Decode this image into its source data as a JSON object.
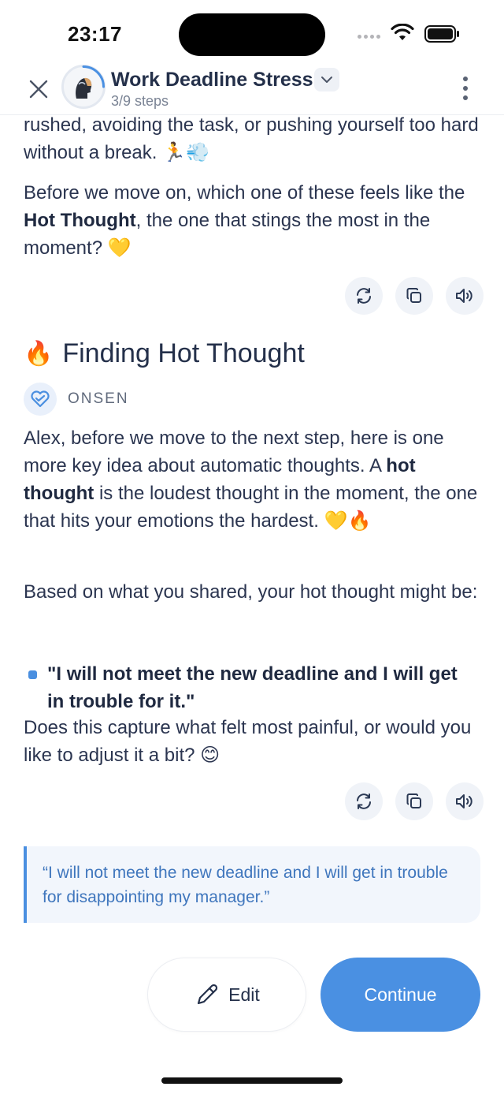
{
  "status_bar": {
    "time": "23:17"
  },
  "header": {
    "title": "Work Deadline Stress",
    "steps": "3/9 steps"
  },
  "message1": {
    "continued_text": "rushed, avoiding the task, or pushing yourself too hard without a break.",
    "question_before": "Before we move on, which one of these feels like the ",
    "question_bold": "Hot Thought",
    "question_after": ", the one that stings the most in the moment?"
  },
  "section": {
    "title": "Finding Hot Thought",
    "author": "ONSEN"
  },
  "message2": {
    "intro_before": "Alex, before we move to the next step, here is one more key idea about automatic thoughts. A ",
    "intro_bold": "hot thought",
    "intro_after": " is the loudest thought in the moment, the one that hits your emotions the hardest.",
    "lead": "Based on what you shared, your hot thought might be:",
    "bullet": "\"I will not meet the new deadline and I will get in trouble for it.\"",
    "question": "Does this capture what felt most painful, or would you like to adjust it a bit?"
  },
  "user_reply": {
    "quote": "“I will not meet the new deadline and I will get in trouble for disappointing my manager.”"
  },
  "buttons": {
    "edit": "Edit",
    "continue": "Continue"
  },
  "icons": {
    "close": "close-icon",
    "chevron": "chevron-down-icon",
    "more": "more-vertical-icon",
    "regenerate": "refresh-icon",
    "copy": "copy-icon",
    "speaker": "speaker-icon",
    "edit": "pencil-icon"
  },
  "colors": {
    "accent": "#4a90e2",
    "quote_text": "#3f76bd",
    "text": "#24304a"
  }
}
